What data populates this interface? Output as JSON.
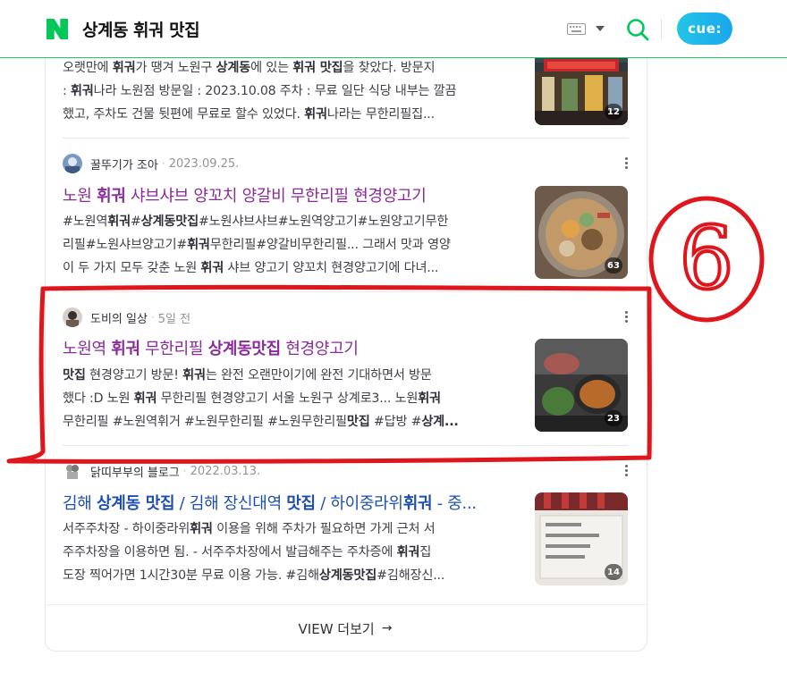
{
  "header": {
    "query": "상계동 휘궈 맛집",
    "logo_letter": "N",
    "cue_label": "cue:",
    "icons": [
      "naver-logo-icon",
      "keyboard-icon",
      "caret-down-icon",
      "search-icon"
    ]
  },
  "results": [
    {
      "desc": [
        [
          [
            "오랫만에 ",
            0
          ],
          [
            "휘궈",
            1
          ],
          [
            "가 땡겨 노원구 ",
            0
          ],
          [
            "상계동",
            1
          ],
          [
            "에 있는 ",
            0
          ],
          [
            "휘궈 맛집",
            1
          ],
          [
            "을 찾았다. 방문지",
            0
          ]
        ],
        [
          [
            ": ",
            0
          ],
          [
            "휘궈",
            1
          ],
          [
            "나라 노원점 방문일 : 2023.10.08 주차 : 무료 일단 식당 내부는 깔끔",
            0
          ]
        ],
        [
          [
            "했고, 주차도 건물 뒷편에 무료로 할수 있었다. ",
            0
          ],
          [
            "휘궈",
            1
          ],
          [
            "나라는 무한리필집...",
            0
          ]
        ]
      ],
      "thumb_count": "12"
    },
    {
      "blog_name": "꿀뚜기가 조아",
      "date": "2023.09.25.",
      "title": [
        [
          "노원 ",
          0
        ],
        [
          "휘궈",
          1
        ],
        [
          " 샤브샤브 양꼬치 양갈비 무한리필 현경양고기",
          0
        ]
      ],
      "desc": [
        [
          [
            "#노원역",
            0
          ],
          [
            "휘궈",
            1
          ],
          [
            "#",
            0
          ],
          [
            "상계동맛집",
            1
          ],
          [
            "#노원샤브샤브#노원역양고기#노원양고기무한",
            0
          ]
        ],
        [
          [
            "리필#노원샤브양고기#",
            0
          ],
          [
            "휘궈",
            1
          ],
          [
            "무한리필#양갈비무한리필... 그래서 맛과 영양",
            0
          ]
        ],
        [
          [
            "이 두 가지 모두 갖춘 노원 ",
            0
          ],
          [
            "휘궈",
            1
          ],
          [
            " 샤브 양고기 양꼬치 현경양고기에 다녀...",
            0
          ]
        ]
      ],
      "thumb_count": "63"
    },
    {
      "blog_name": "도비의 일상",
      "date": "5일 전",
      "title": [
        [
          "노원역 ",
          0
        ],
        [
          "휘궈",
          1
        ],
        [
          " 무한리필 ",
          0
        ],
        [
          "상계동맛집",
          1
        ],
        [
          " 현경양고기",
          0
        ]
      ],
      "desc": [
        [
          [
            "맛집",
            1
          ],
          [
            " 현경양고기 방문! ",
            0
          ],
          [
            "휘궈",
            1
          ],
          [
            "는 완전 오랜만이기에 완전 기대하면서 방문",
            0
          ]
        ],
        [
          [
            "했다 :D 노원 ",
            0
          ],
          [
            "휘궈",
            1
          ],
          [
            " 무한리필 현경양고기 서울 노원구 상계로3... 노원",
            0
          ],
          [
            "휘궈",
            1
          ]
        ],
        [
          [
            "무한리필 #노원역휘거 #노원무한리필 #노원무한리필",
            0
          ],
          [
            "맛집",
            1
          ],
          [
            " #답방 #",
            0
          ],
          [
            "상계...",
            1
          ]
        ]
      ],
      "thumb_count": "23"
    },
    {
      "blog_name": "닭띠부부의 블로그",
      "date": "2022.03.13.",
      "title": [
        [
          "김해 ",
          0
        ],
        [
          "상계동 맛집",
          1
        ],
        [
          " / 김해 장신대역 ",
          0
        ],
        [
          "맛집",
          1
        ],
        [
          " / 하이중라위",
          0
        ],
        [
          "휘궈",
          1
        ],
        [
          " - 중...",
          0
        ]
      ],
      "desc": [
        [
          [
            "서주주차장 - 하이중라위",
            0
          ],
          [
            "휘궈",
            1
          ],
          [
            " 이용을 위해 주차가 필요하면 가게 근처 서",
            0
          ]
        ],
        [
          [
            "주주차장을 이용하면 됨. - 서주주차장에서 발급해주는 주차증에 ",
            0
          ],
          [
            "휘궈",
            1
          ],
          [
            "집",
            0
          ]
        ],
        [
          [
            "도장 찍어가면 1시간30분 무료 이용 가능. #김해",
            0
          ],
          [
            "상계동맛집",
            1
          ],
          [
            "#김해장신...",
            0
          ]
        ]
      ],
      "thumb_count": "14"
    }
  ],
  "more_button": {
    "label": "VIEW 더보기",
    "arrow": "→"
  },
  "annotation": {
    "number": "6",
    "color": "#e0161d"
  },
  "colors": {
    "visited": "#8b2a9b",
    "unvisited": "#1d4fb2",
    "brand_green": "#19ce60"
  }
}
